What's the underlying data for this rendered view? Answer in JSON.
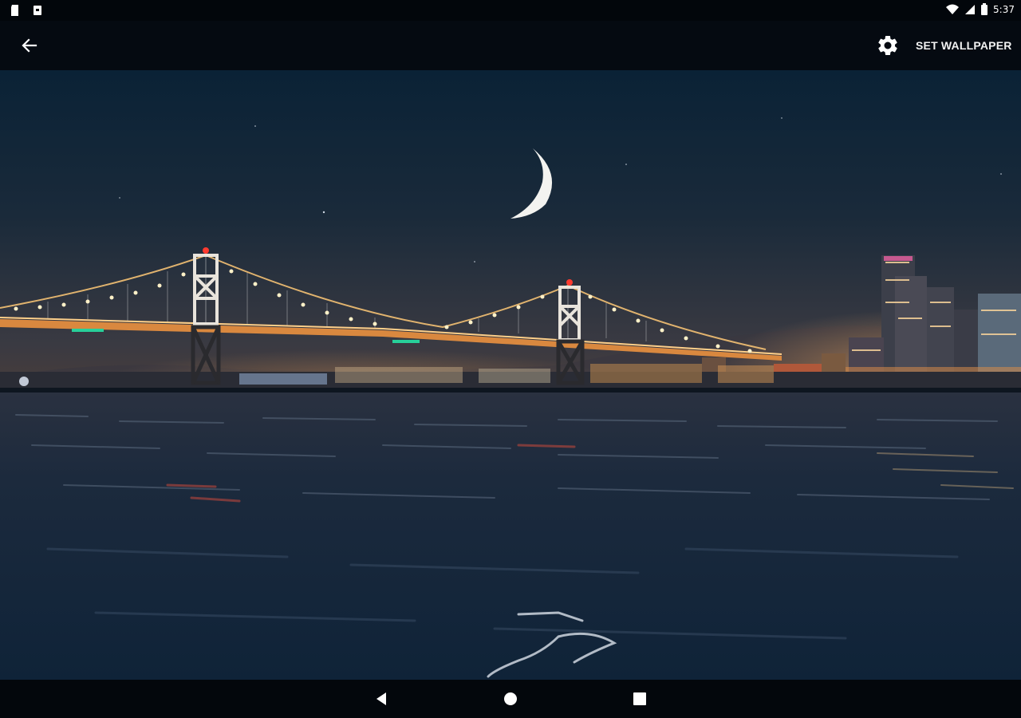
{
  "status_bar": {
    "time": "5:37",
    "left_icons": [
      "sd-card-icon",
      "notification-icon"
    ],
    "right_icons": [
      "wifi-icon",
      "signal-icon",
      "battery-icon"
    ]
  },
  "app_bar": {
    "back_icon": "arrow-back-icon",
    "settings_icon": "gear-icon",
    "set_wallpaper_label": "SET WALLPAPER"
  },
  "wallpaper": {
    "subject": "night-bridge-moon-city-water"
  },
  "nav_bar": {
    "buttons": [
      "back-triangle-icon",
      "home-circle-icon",
      "recents-square-icon"
    ]
  },
  "colors": {
    "sky_top": "#0a2236",
    "sky_horizon": "#3a3a42",
    "water": "#16273b",
    "bridge_lights": "#f4c173",
    "accent_red": "#ff3b30"
  }
}
